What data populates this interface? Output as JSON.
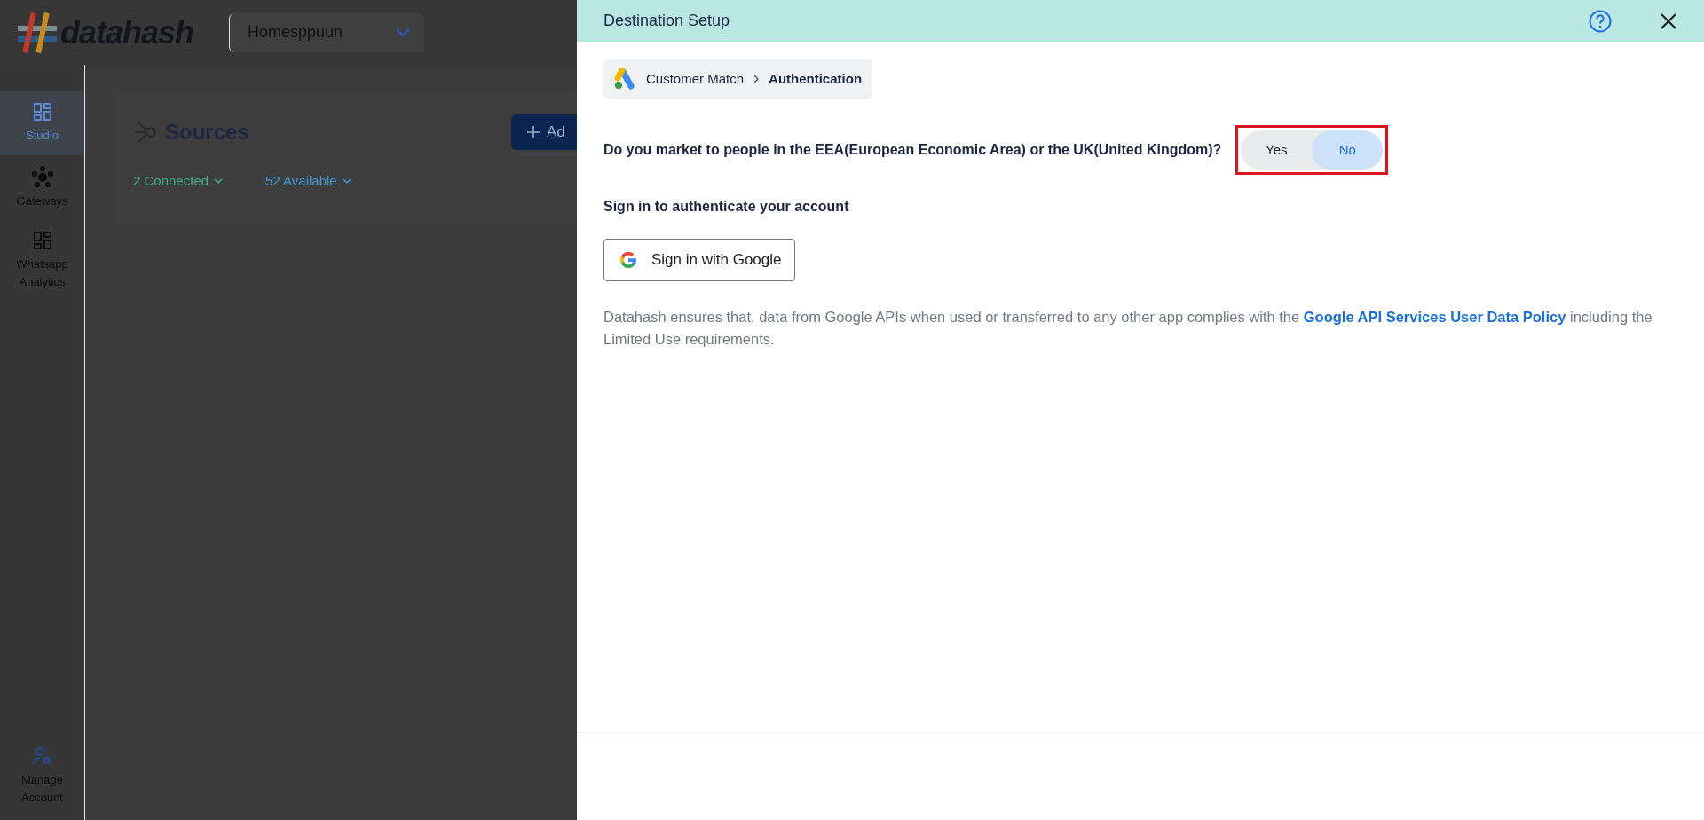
{
  "app": {
    "logo": "datahash",
    "workspace": "Homesppuun"
  },
  "sidebar": {
    "items": [
      {
        "label": "Studio",
        "selected": true
      },
      {
        "label": "Gateways",
        "selected": false
      },
      {
        "label": "Whatsapp Analytics",
        "selected": false
      }
    ],
    "footer_item": "Manage Account"
  },
  "sources": {
    "title": "Sources",
    "add_button": "Ad",
    "filters": [
      "2 Connected",
      "52 Available"
    ]
  },
  "drawer": {
    "title": "Destination Setup",
    "breadcrumb": [
      "Customer Match",
      "Authentication"
    ],
    "question": "Do you market to people in the EEA(European Economic Area) or the UK(United Kingdom)?",
    "toggle": {
      "highlighted": true,
      "options": [
        {
          "label": "Yes",
          "selected": false
        },
        {
          "label": "No",
          "selected": true
        }
      ]
    },
    "signin_heading": "Sign in to authenticate your account",
    "google_button": "Sign in with Google",
    "notice": {
      "before": "Datahash ensures that, data from Google APIs when used or transferred to any other app complies with the",
      "link": "Google API Services User Data Policy",
      "after": "including the Limited Use requirements."
    }
  }
}
